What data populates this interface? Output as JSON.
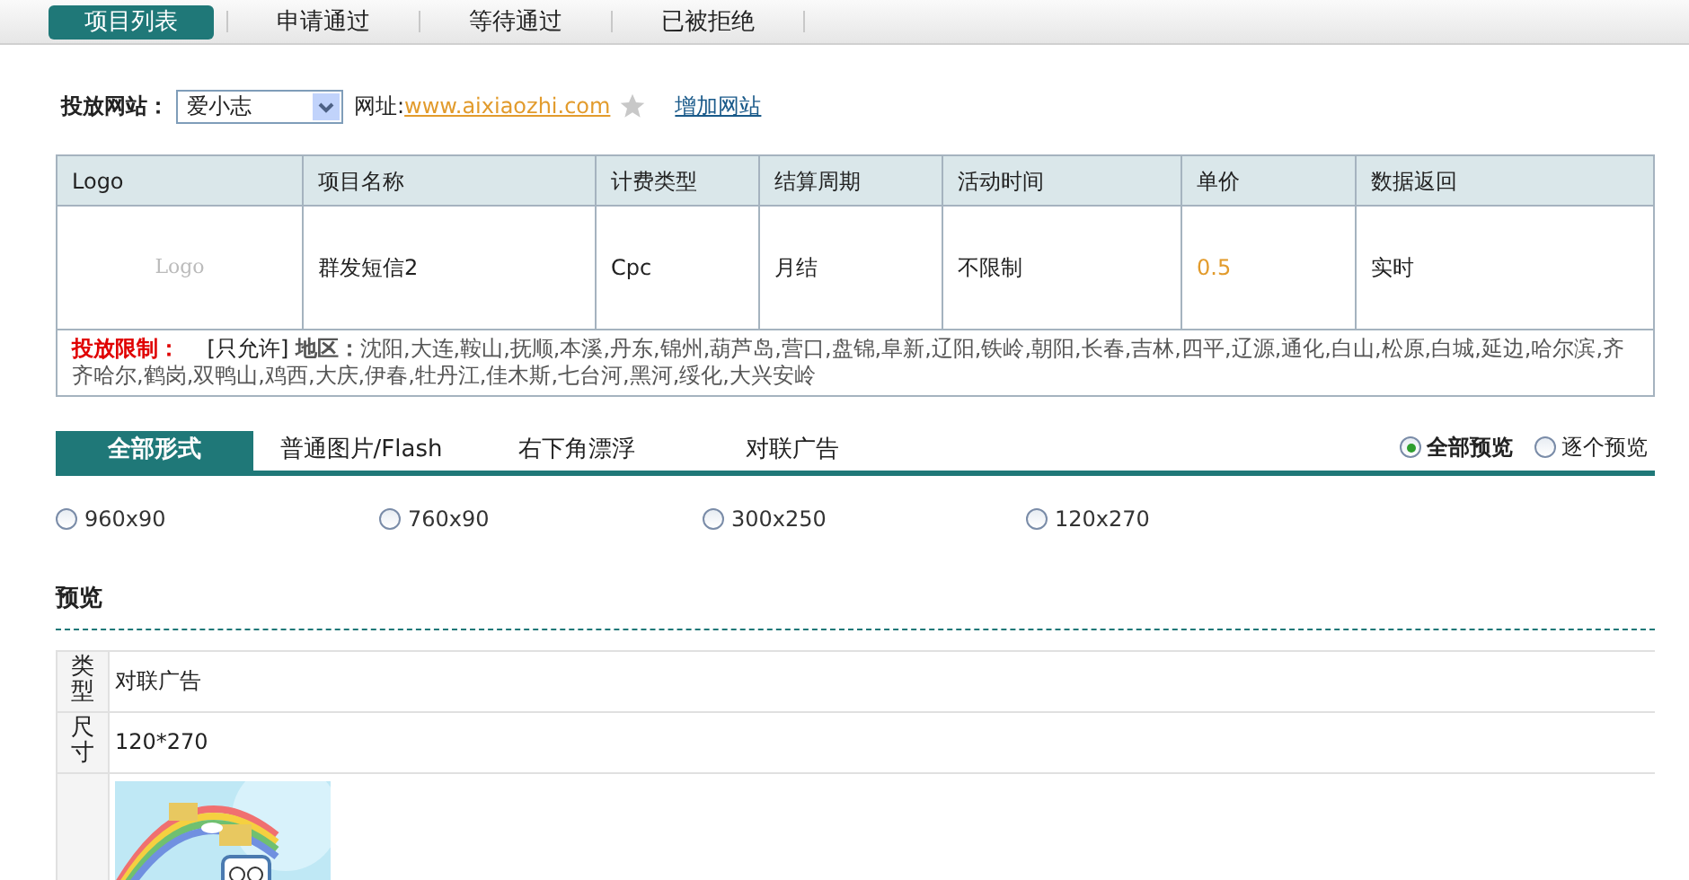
{
  "top_tabs": [
    {
      "label": "项目列表",
      "selected": true
    },
    {
      "label": "申请通过",
      "selected": false
    },
    {
      "label": "等待通过",
      "selected": false
    },
    {
      "label": "已被拒绝",
      "selected": false
    }
  ],
  "site_bar": {
    "label": "投放网站：",
    "site_select": "爱小志",
    "url_label": "网址:",
    "url": "www.aixiaozhi.com",
    "add_link": "增加网站"
  },
  "table": {
    "columns": [
      "Logo",
      "项目名称",
      "计费类型",
      "结算周期",
      "活动时间",
      "单价",
      "数据返回"
    ],
    "rows": [
      {
        "logo": "Logo",
        "name": "群发短信2",
        "billing": "Cpc",
        "settlement": "月结",
        "period": "不限制",
        "price": "0.5",
        "data_return": "实时"
      }
    ],
    "limits": {
      "label": "投放限制：",
      "allow": "[只允许]",
      "region_label": "地区：",
      "regions": "沈阳,大连,鞍山,抚顺,本溪,丹东,锦州,葫芦岛,营口,盘锦,阜新,辽阳,铁岭,朝阳,长春,吉林,四平,辽源,通化,白山,松原,白城,延边,哈尔滨,齐齐哈尔,鹤岗,双鸭山,鸡西,大庆,伊春,牡丹江,佳木斯,七台河,黑河,绥化,大兴安岭"
    }
  },
  "format_tabs": [
    {
      "label": "全部形式",
      "selected": true
    },
    {
      "label": "普通图片/Flash",
      "selected": false
    },
    {
      "label": "右下角漂浮",
      "selected": false
    },
    {
      "label": "对联广告",
      "selected": false
    }
  ],
  "preview_modes": [
    {
      "label": "全部预览",
      "selected": true
    },
    {
      "label": "逐个预览",
      "selected": false
    }
  ],
  "sizes": [
    {
      "label": "960x90",
      "selected": false
    },
    {
      "label": "760x90",
      "selected": false
    },
    {
      "label": "300x250",
      "selected": false
    },
    {
      "label": "120x270",
      "selected": false
    }
  ],
  "preview": {
    "title": "预览",
    "rows": [
      {
        "kind": "text",
        "label": "类型",
        "value": "对联广告"
      },
      {
        "kind": "text",
        "label": "尺寸",
        "value": "120*270"
      },
      {
        "kind": "picture"
      }
    ]
  }
}
